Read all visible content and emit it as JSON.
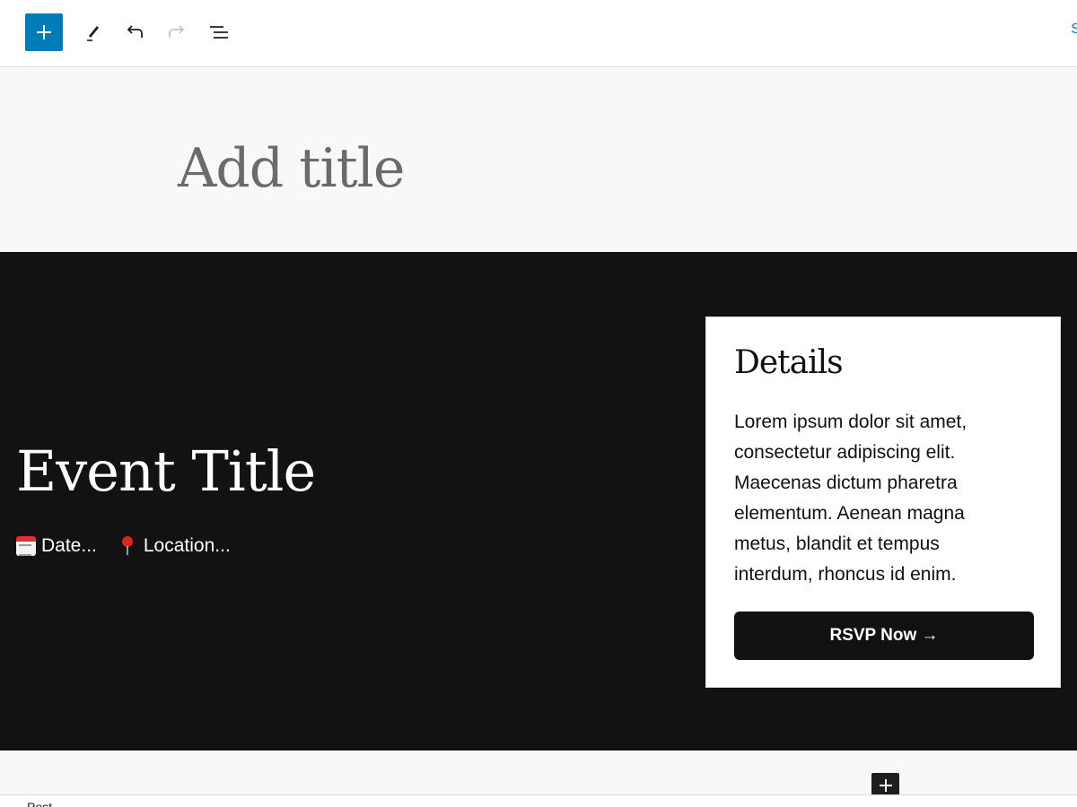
{
  "toolbar": {
    "add_icon": "plus-icon",
    "edit_icon": "pencil-icon",
    "undo_icon": "undo-icon",
    "redo_icon": "redo-icon",
    "list_view_icon": "list-view-icon",
    "right_text": "S",
    "accent_color": "#007cba"
  },
  "editor": {
    "title_placeholder": "Add title"
  },
  "event": {
    "title": "Event Title",
    "date_label": "Date...",
    "date_icon": "calendar-icon",
    "location_label": "Location...",
    "location_icon": "pin-icon",
    "background_color": "#121212"
  },
  "details": {
    "heading": "Details",
    "body": "Lorem ipsum dolor sit amet, consectetur adipiscing elit. Maecenas dictum pharetra elementum. Aenean magna metus, blandit et tempus interdum, rhoncus id enim.",
    "button_label": "RSVP Now →"
  },
  "footer": {
    "breadcrumb": "Post"
  }
}
